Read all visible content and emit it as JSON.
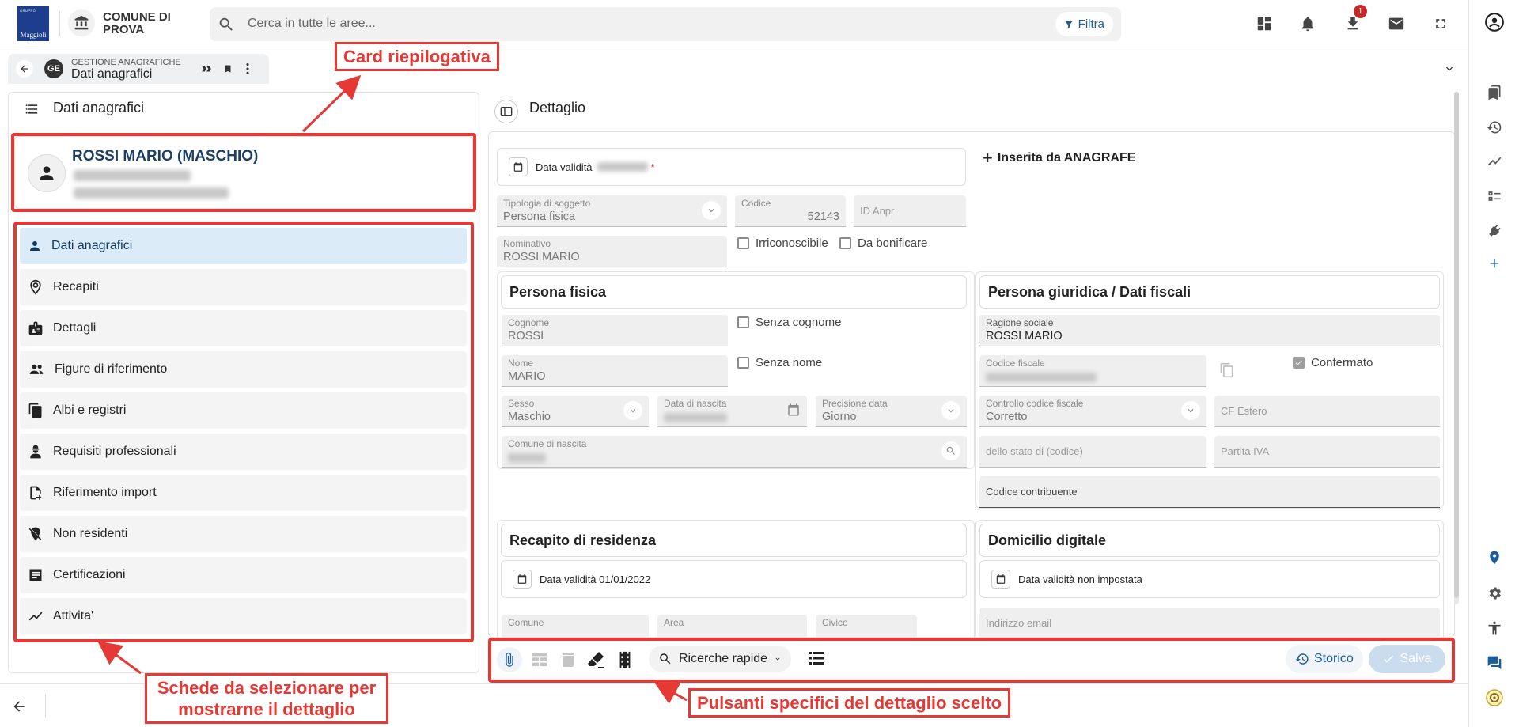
{
  "header": {
    "logo_small": "GRUPPO",
    "logo_text": "Maggioli",
    "comune": "COMUNE DI PROVA",
    "search_placeholder": "Cerca in tutte le aree...",
    "filter_label": "Filtra",
    "download_badge": "1"
  },
  "tab": {
    "subtitle": "GESTIONE ANAGRAFICHE",
    "title": "Dati anagrafici",
    "app_badge": "GE"
  },
  "left": {
    "title": "Dati anagrafici",
    "person_name": "ROSSI MARIO (MASCHIO)",
    "nav": [
      {
        "label": "Dati anagrafici",
        "icon": "person-icon"
      },
      {
        "label": "Recapiti",
        "icon": "location-icon"
      },
      {
        "label": "Dettagli",
        "icon": "badge-icon"
      },
      {
        "label": "Figure di riferimento",
        "icon": "people-icon"
      },
      {
        "label": "Albi e registri",
        "icon": "documents-icon"
      },
      {
        "label": "Requisiti professionali",
        "icon": "worker-icon"
      },
      {
        "label": "Riferimento import",
        "icon": "file-import-icon"
      },
      {
        "label": "Non residenti",
        "icon": "location-off-icon"
      },
      {
        "label": "Certificazioni",
        "icon": "list-icon"
      },
      {
        "label": "Attivita'",
        "icon": "trend-icon"
      }
    ]
  },
  "detail": {
    "title": "Dettaglio",
    "validity_label": "Data validità",
    "inserted_by": "Inserita da ANAGRAFE",
    "tipologia_label": "Tipologia di soggetto",
    "tipologia_value": "Persona fisica",
    "codice_label": "Codice",
    "codice_value": "52143",
    "id_anpr_label": "ID Anpr",
    "nominativo_label": "Nominativo",
    "nominativo_value": "ROSSI MARIO",
    "irriconoscibile": "Irriconoscibile",
    "da_bonificare": "Da bonificare",
    "persona_fisica": {
      "title": "Persona fisica",
      "cognome_label": "Cognome",
      "cognome_value": "ROSSI",
      "senza_cognome": "Senza cognome",
      "nome_label": "Nome",
      "nome_value": "MARIO",
      "senza_nome": "Senza nome",
      "sesso_label": "Sesso",
      "sesso_value": "Maschio",
      "nascita_label": "Data di nascita",
      "precisione_label": "Precisione data",
      "precisione_value": "Giorno",
      "comune_nascita_label": "Comune di nascita"
    },
    "giuridica": {
      "title": "Persona giuridica / Dati fiscali",
      "ragione_label": "Ragione sociale",
      "ragione_value": "ROSSI MARIO",
      "cf_label": "Codice fiscale",
      "confermato": "Confermato",
      "controllo_label": "Controllo codice fiscale",
      "controllo_value": "Corretto",
      "cf_estero": "CF Estero",
      "stato": "dello stato di (codice)",
      "piva": "Partita IVA",
      "contribuente": "Codice contribuente"
    },
    "recapito": {
      "title": "Recapito di residenza",
      "validity": "Data validità 01/01/2022",
      "comune": "Comune",
      "area": "Area",
      "civico": "Civico"
    },
    "domicilio": {
      "title": "Domicilio digitale",
      "validity": "Data validità non impostata",
      "email": "Indirizzo email"
    }
  },
  "toolbar": {
    "quick_search": "Ricerche rapide",
    "storico": "Storico",
    "salva": "Salva"
  },
  "annotations": {
    "card": "Card riepilogativa",
    "tabs": "Schede da selezionare per mostrarne il dettaglio",
    "buttons": "Pulsanti specifici del dettaglio scelto"
  },
  "colors": {
    "annotation": "#e53935",
    "accent": "#1a5d9c",
    "active_nav": "#dbebf8"
  }
}
